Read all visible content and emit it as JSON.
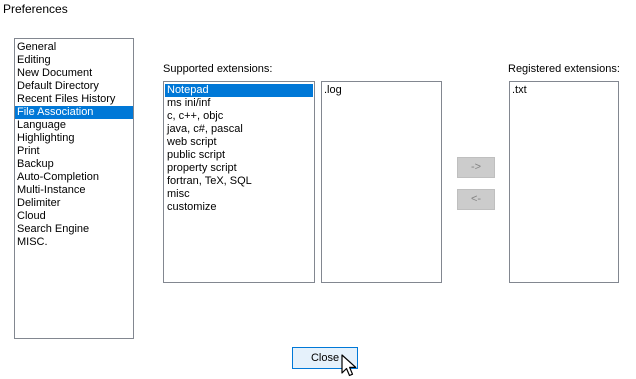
{
  "window": {
    "title": "Preferences"
  },
  "categories": {
    "items": [
      {
        "label": "General",
        "selected": false
      },
      {
        "label": "Editing",
        "selected": false
      },
      {
        "label": "New Document",
        "selected": false
      },
      {
        "label": "Default Directory",
        "selected": false
      },
      {
        "label": "Recent Files History",
        "selected": false
      },
      {
        "label": "File Association",
        "selected": true
      },
      {
        "label": "Language",
        "selected": false
      },
      {
        "label": "Highlighting",
        "selected": false
      },
      {
        "label": "Print",
        "selected": false
      },
      {
        "label": "Backup",
        "selected": false
      },
      {
        "label": "Auto-Completion",
        "selected": false
      },
      {
        "label": "Multi-Instance",
        "selected": false
      },
      {
        "label": "Delimiter",
        "selected": false
      },
      {
        "label": "Cloud",
        "selected": false
      },
      {
        "label": "Search Engine",
        "selected": false
      },
      {
        "label": "MISC.",
        "selected": false
      }
    ]
  },
  "supported": {
    "label": "Supported extensions:",
    "items": [
      {
        "label": "Notepad",
        "selected": true
      },
      {
        "label": "ms ini/inf",
        "selected": false
      },
      {
        "label": "c, c++, objc",
        "selected": false
      },
      {
        "label": "java, c#, pascal",
        "selected": false
      },
      {
        "label": "web script",
        "selected": false
      },
      {
        "label": "public script",
        "selected": false
      },
      {
        "label": "property script",
        "selected": false
      },
      {
        "label": "fortran, TeX, SQL",
        "selected": false
      },
      {
        "label": "misc",
        "selected": false
      },
      {
        "label": "customize",
        "selected": false
      }
    ]
  },
  "extensions": {
    "items": [
      {
        "label": ".log",
        "selected": false
      }
    ]
  },
  "registered": {
    "label": "Registered extensions:",
    "items": [
      {
        "label": ".txt",
        "selected": false
      }
    ]
  },
  "buttons": {
    "add_label": "->",
    "remove_label": "<-",
    "close_label": "Close"
  },
  "colors": {
    "selection": "#0078d7",
    "listbox_border": "#828790",
    "disabled_button": "#cccccc",
    "focused_button_border": "#0078d7"
  }
}
